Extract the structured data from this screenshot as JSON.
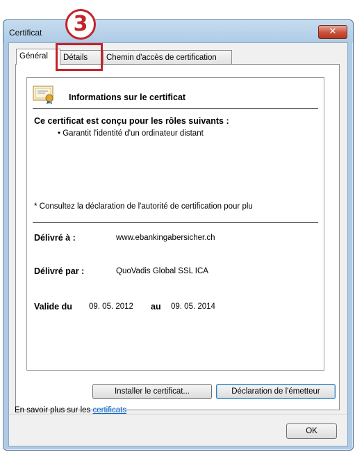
{
  "window": {
    "title": "Certificat",
    "close_glyph": "✕"
  },
  "annotation": {
    "step_number": "3"
  },
  "tabs": [
    {
      "label": "Général",
      "active": true
    },
    {
      "label": "Détails",
      "active": false
    },
    {
      "label": "Chemin d'accès de certification",
      "active": false
    }
  ],
  "general": {
    "icon": "certificate-icon",
    "info_title": "Informations sur le certificat",
    "roles_heading": "Ce certificat est conçu pour les rôles suivants :",
    "roles": [
      "• Garantit l'identité d'un ordinateur distant"
    ],
    "note": "* Consultez la déclaration de l'autorité de certification pour plu",
    "issued_to_label": "Délivré à :",
    "issued_to_value": "www.ebankingabersicher.ch",
    "issued_by_label": "Délivré par :",
    "issued_by_value": "QuoVadis Global SSL ICA",
    "valid_from_label": "Valide du",
    "valid_from_value": "09. 05. 2012",
    "valid_to_label": "au",
    "valid_to_value": "09. 05. 2014"
  },
  "buttons": {
    "install": "Installer le certificat...",
    "issuer_statement": "Déclaration de l'émetteur",
    "ok": "OK"
  },
  "learn_more": {
    "prefix": "En savoir plus sur les ",
    "link": "certificats"
  },
  "colors": {
    "annotation_red": "#c4222b",
    "link": "#0066cc",
    "frame": "#aecbe6"
  }
}
